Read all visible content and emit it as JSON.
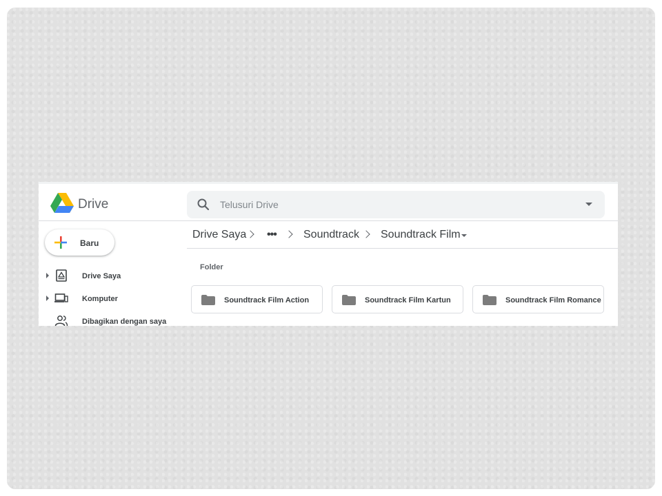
{
  "app": {
    "brand": "Drive"
  },
  "search": {
    "placeholder": "Telusuri Drive"
  },
  "new_button": {
    "label": "Baru"
  },
  "sidebar": {
    "items": [
      {
        "label": "Drive Saya",
        "icon": "drive-icon",
        "expandable": true
      },
      {
        "label": "Komputer",
        "icon": "computer-icon",
        "expandable": true
      },
      {
        "label": "Dibagikan dengan saya",
        "icon": "shared-people-icon",
        "expandable": false
      }
    ]
  },
  "breadcrumb": {
    "items": [
      "Drive Saya",
      "•••",
      "Soundtrack",
      "Soundtrack Film"
    ]
  },
  "main": {
    "section_label": "Folder",
    "folders": [
      {
        "name": "Soundtrack Film Action"
      },
      {
        "name": "Soundtrack Film Kartun"
      },
      {
        "name": "Soundtrack Film Romance"
      }
    ]
  },
  "colors": {
    "slide_background": "#e1e1e1",
    "folder_icon": "#7c7c7c",
    "text_primary": "#3c4043",
    "google_blue": "#4285f4",
    "google_red": "#ea4335",
    "google_yellow": "#fbbc04",
    "google_green": "#34a853"
  }
}
